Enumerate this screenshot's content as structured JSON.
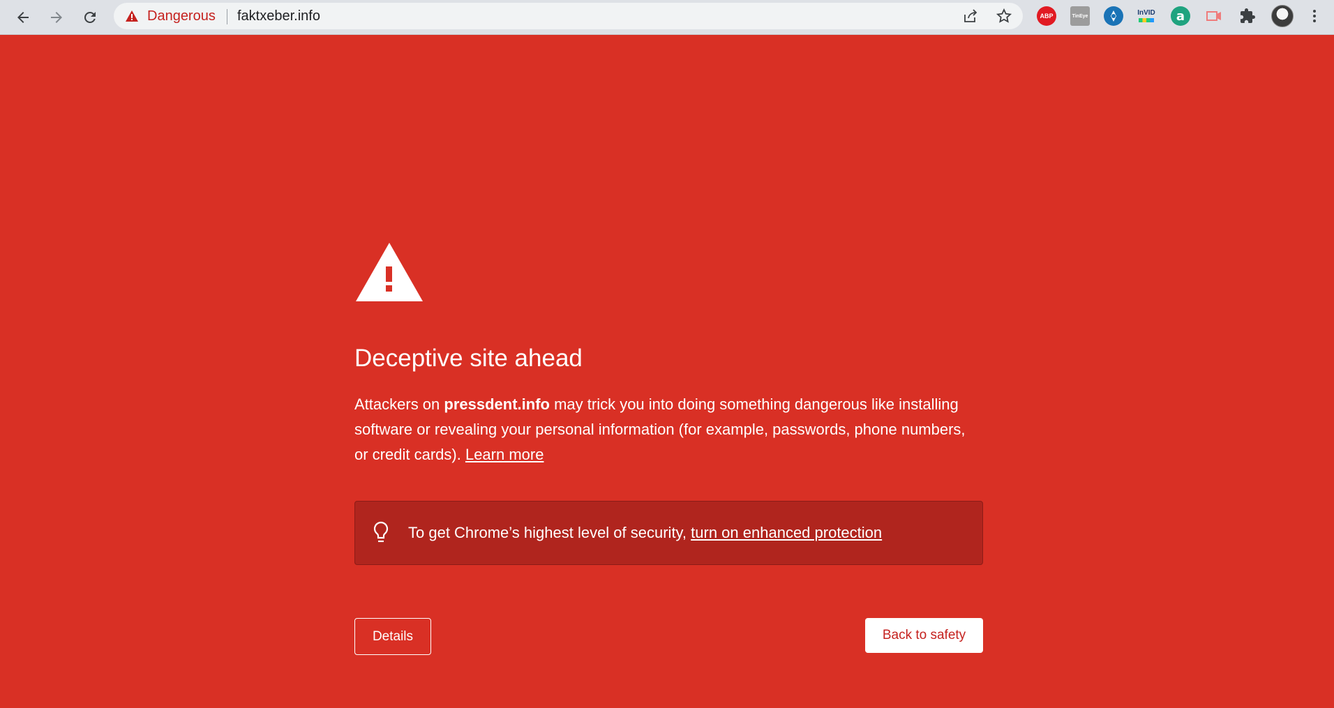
{
  "toolbar": {
    "back_icon": "arrow-left-icon",
    "forward_icon": "arrow-right-icon",
    "reload_icon": "reload-icon",
    "security_state": "Dangerous",
    "url": "faktxeber.info",
    "share_icon": "share-icon",
    "bookmark_icon": "star-icon",
    "extensions": [
      {
        "name": "adblock-plus-icon",
        "text": "ABP"
      },
      {
        "name": "tineye-icon",
        "text": "TinEye"
      },
      {
        "name": "crosshair-extension-icon",
        "text": ""
      },
      {
        "name": "invid-icon",
        "text": "InVID"
      },
      {
        "name": "a-extension-icon",
        "text": "a"
      },
      {
        "name": "record-extension-icon",
        "text": ""
      },
      {
        "name": "puzzle-icon",
        "text": ""
      }
    ],
    "menu_icon": "kebab-menu-icon"
  },
  "interstitial": {
    "heading": "Deceptive site ahead",
    "message_prefix": "Attackers on ",
    "site": "pressdent.info",
    "message_suffix": " may trick you into doing something dangerous like installing software or revealing your personal information (for example, passwords, phone numbers, or credit cards).",
    "learn_more": "Learn more",
    "promo_text": "To get Chrome’s highest level of security, ",
    "promo_link": "turn on enhanced protection",
    "details_button": "Details",
    "back_button": "Back to safety"
  },
  "colors": {
    "background": "#d93025",
    "promo_background": "#b0251e",
    "danger_text": "#c5221f",
    "toolbar": "#dee1e6"
  }
}
